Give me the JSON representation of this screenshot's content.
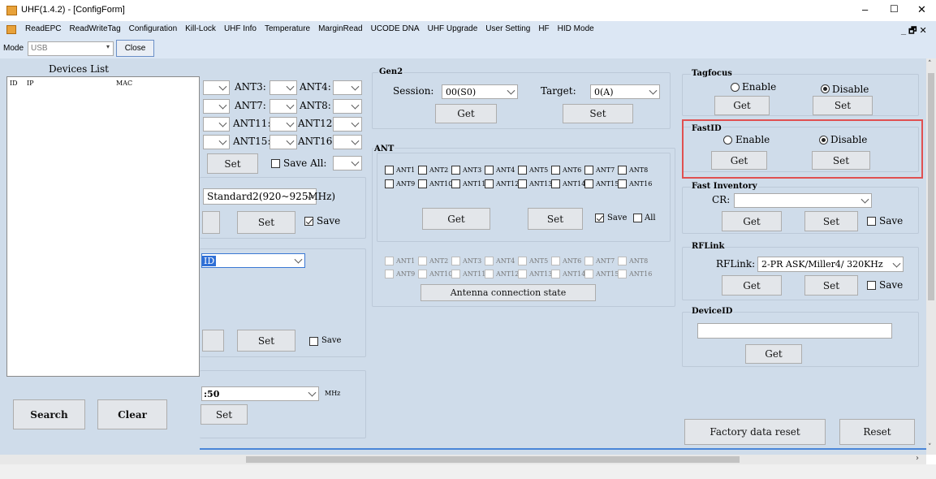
{
  "window": {
    "title": "UHF(1.4.2) - [ConfigForm]",
    "minimize": "–",
    "maximize": "☐",
    "close": "✕"
  },
  "menu": {
    "items": [
      "ReadEPC",
      "ReadWriteTag",
      "Configuration",
      "Kill-Lock",
      "UHF Info",
      "Temperature",
      "MarginRead",
      "UCODE DNA",
      "UHF Upgrade",
      "User Setting",
      "HF",
      "HID Mode"
    ],
    "mdi_controls": "_ 🗗 ✕"
  },
  "toolbar": {
    "mode_label": "Mode",
    "mode_value": "USB",
    "close_button": "Close"
  },
  "devices": {
    "title": "Devices List",
    "columns": [
      "ID",
      "IP",
      "MAC"
    ],
    "search_button": "Search",
    "clear_button": "Clear"
  },
  "left_panel": {
    "ant_labels": [
      "ANT3:",
      "ANT4:",
      "ANT7:",
      "ANT8:",
      "ANT11:",
      "ANT12:",
      "ANT15:",
      "ANT16:"
    ],
    "set_button": "Set",
    "save_all_label": "Save All:",
    "region_value": "Standard2(920~925MHz)",
    "region_set": "Set",
    "region_save": "Save",
    "id_value": "ID",
    "set_button2": "Set",
    "save_label2": "Save",
    "freq_value": ":50",
    "freq_unit": "MHz",
    "freq_set": "Set"
  },
  "gen2": {
    "title": "Gen2",
    "session_label": "Session:",
    "session_value": "00(S0)",
    "target_label": "Target:",
    "target_value": "0(A)",
    "get_button": "Get",
    "set_button": "Set"
  },
  "ant": {
    "title": "ANT",
    "row1": [
      "ANT1",
      "ANT2",
      "ANT3",
      "ANT4",
      "ANT5",
      "ANT6",
      "ANT7",
      "ANT8"
    ],
    "row2": [
      "ANT9",
      "ANT10",
      "ANT11",
      "ANT12",
      "ANT13",
      "ANT14",
      "ANT15",
      "ANT16"
    ],
    "get_button": "Get",
    "set_button": "Set",
    "save_label": "Save",
    "all_label": "All",
    "state_row1": [
      "ANT1",
      "ANT2",
      "ANT3",
      "ANT4",
      "ANT5",
      "ANT6",
      "ANT7",
      "ANT8"
    ],
    "state_row2": [
      "ANT9",
      "ANT10",
      "ANT11",
      "ANT12",
      "ANT13",
      "ANT14",
      "ANT15",
      "ANT16"
    ],
    "state_button": "Antenna connection state"
  },
  "tagfocus": {
    "title": "Tagfocus",
    "enable": "Enable",
    "disable": "Disable",
    "get": "Get",
    "set": "Set"
  },
  "fastid": {
    "title": "FastID",
    "enable": "Enable",
    "disable": "Disable",
    "get": "Get",
    "set": "Set",
    "highlight_color": "#e05050"
  },
  "fast_inventory": {
    "title": "Fast Inventory",
    "cr_label": "CR:",
    "get": "Get",
    "set": "Set",
    "save": "Save"
  },
  "rflink": {
    "title": "RFLink",
    "label": "RFLink:",
    "value": "2-PR ASK/Miller4/ 320KHz",
    "get": "Get",
    "set": "Set",
    "save": "Save"
  },
  "deviceid": {
    "title": "DeviceID",
    "get": "Get"
  },
  "bottom": {
    "factory_reset": "Factory data reset",
    "reset": "Reset"
  },
  "colors": {
    "client_bg": "#cfdcea",
    "menu_bg": "#dce7f4",
    "accent": "#4a86d8"
  }
}
